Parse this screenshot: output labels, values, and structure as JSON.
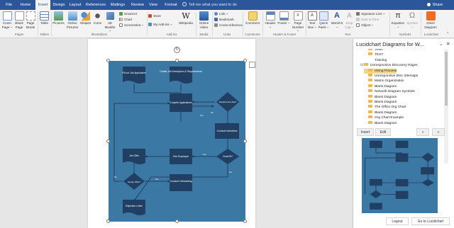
{
  "tabs": [
    {
      "label": "File",
      "active": false
    },
    {
      "label": "Home",
      "active": false
    },
    {
      "label": "Insert",
      "active": true
    },
    {
      "label": "Design",
      "active": false
    },
    {
      "label": "Layout",
      "active": false
    },
    {
      "label": "References",
      "active": false
    },
    {
      "label": "Mailings",
      "active": false
    },
    {
      "label": "Review",
      "active": false
    },
    {
      "label": "View",
      "active": false
    },
    {
      "label": "Format",
      "active": false
    }
  ],
  "tell_me": "Tell me what you want to do",
  "share_label": "Share",
  "ribbon": {
    "pages": {
      "cover": "Cover Page ~",
      "blank": "Blank Page",
      "break": "Page Break",
      "group": "Pages"
    },
    "tables": {
      "table": "Table",
      "group": "Tables"
    },
    "illustrations": {
      "pictures": "Pictures",
      "online": "Online Pictures",
      "shapes": "Shapes",
      "icons": "Icons",
      "models": "3D Models ~",
      "smartart": "SmartArt",
      "chart": "Chart",
      "screenshot": "Screenshot ~",
      "group": "Illustrations"
    },
    "addins": {
      "store": "Store",
      "my": "My Add-ins ~",
      "wiki": "Wikipedia",
      "group": "Add-ins"
    },
    "media": {
      "video": "Online Video",
      "group": "Media"
    },
    "links": {
      "link": "Link ~",
      "bookmark": "Bookmark",
      "xref": "Cross-reference",
      "group": "Links"
    },
    "comments": {
      "comment": "Comment",
      "group": "Comments"
    },
    "hf": {
      "header": "Header ~",
      "footer": "Footer ~",
      "page_number": "Page Number ~",
      "group": "Header & Footer"
    },
    "text": {
      "textbox": "Text Box ~",
      "quick": "Quick Parts ~",
      "wordart": "WordArt ~",
      "dropcap": "Drop Cap ~",
      "sig": "Signature Line ~",
      "date": "Date & Time",
      "object": "Object ~",
      "group": "Text"
    },
    "symbols": {
      "equation": "Equation ~",
      "symbol": "Symbol ~",
      "group": "Symbols"
    },
    "lucid": {
      "insert": "Insert Diagram",
      "group": "Lucidchart"
    }
  },
  "diagram": {
    "fill_out": "Fill out Job Application",
    "create_job": "Create Job Description & Requirements",
    "compile": "Compile Applications",
    "requirements": "Requirements Met?",
    "yes1": "Yes",
    "no1": "No",
    "conduct_interviews": "Conduct Interviews",
    "job_offer": "Job Offer",
    "hire_employee": "Hire Employee",
    "yes2": "Yes",
    "good_fit": "Good fit?",
    "no2": "No",
    "no3": "No",
    "accept_offer": "Accept Offer?",
    "yes3": "Yes",
    "onboarding": "Conduct Onboarding",
    "rejection": "Rejection Letter"
  },
  "pane": {
    "title": "Lucidchart Diagrams for W...",
    "close": "✕",
    "collapse": "⌄",
    "tree": [
      {
        "label": "Team",
        "level": 2,
        "folder": true,
        "toggle": ""
      },
      {
        "label": "TEST",
        "level": 2,
        "folder": true,
        "toggle": ""
      },
      {
        "label": "Training",
        "level": 2,
        "folder": false,
        "toggle": ""
      },
      {
        "label": "Unresponsive Discovery Pages",
        "level": 1,
        "folder": true,
        "toggle": "⊟"
      },
      {
        "label": "Hiring Process",
        "level": 2,
        "folder": true,
        "toggle": "",
        "selected": true
      },
      {
        "label": "Unresponsive Disc Sitemaps",
        "level": 2,
        "folder": true,
        "toggle": ""
      },
      {
        "label": "Matrix Organization",
        "level": 2,
        "folder": true,
        "toggle": ""
      },
      {
        "label": "Blank Diagram",
        "level": 2,
        "folder": true,
        "toggle": ""
      },
      {
        "label": "Network Diagram Symbols",
        "level": 2,
        "folder": true,
        "toggle": ""
      },
      {
        "label": "Blank Diagram",
        "level": 2,
        "folder": true,
        "toggle": ""
      },
      {
        "label": "Blank Diagram",
        "level": 2,
        "folder": true,
        "toggle": ""
      },
      {
        "label": "The Office Org Chart",
        "level": 2,
        "folder": true,
        "toggle": ""
      },
      {
        "label": "Blank Diagram",
        "level": 2,
        "folder": true,
        "toggle": ""
      },
      {
        "label": "Org Chart Example",
        "level": 2,
        "folder": true,
        "toggle": ""
      },
      {
        "label": "Blank Diagram",
        "level": 2,
        "folder": true,
        "toggle": ""
      }
    ],
    "insert": "Insert",
    "edit": "Edit",
    "prev": "«",
    "next": "»",
    "logout": "Logout",
    "goto": "Go to Lucidchart"
  },
  "colors": {
    "word_blue": "#2b579a",
    "diagram_bg": "#3b78a3",
    "node": "#213f63",
    "selected": "#f7d489"
  }
}
